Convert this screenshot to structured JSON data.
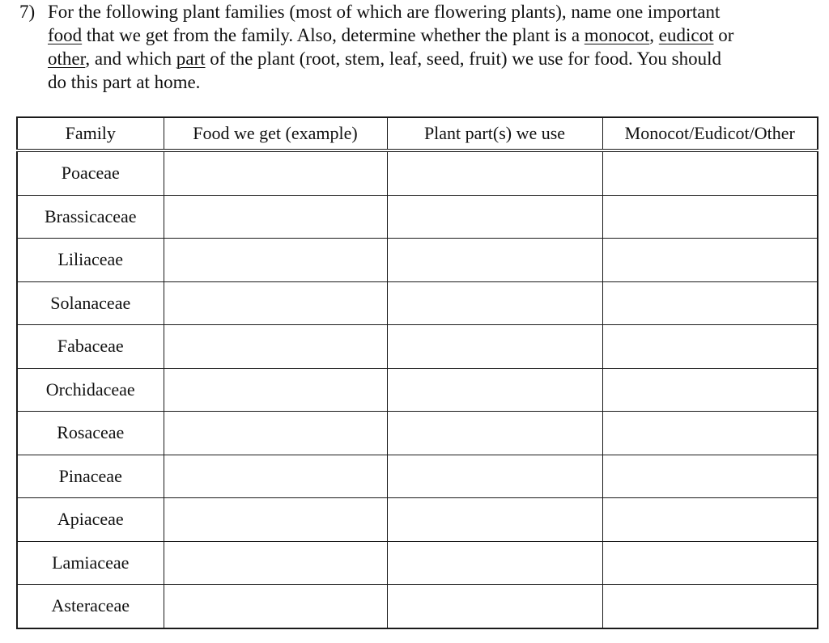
{
  "question": {
    "number": "7)",
    "line1": "For the following plant families (most of which are flowering plants), name one important",
    "line2_u1": "food",
    "line2_a": " that we get from the family. Also, determine whether the plant is a ",
    "line2_u2": "monocot",
    "line2_b": ", ",
    "line2_u3": "eudicot",
    "line2_c": " or",
    "line3_u1": "other",
    "line3_a": ", and which ",
    "line3_u2": "part",
    "line3_b": " of the plant (root, stem, leaf, seed, fruit) we use for food. You should",
    "line4": "do this part at home."
  },
  "table": {
    "headers": [
      "Family",
      "Food we get (example)",
      "Plant part(s) we use",
      "Monocot/Eudicot/Other"
    ],
    "rows": [
      {
        "family": "Poaceae",
        "food": "",
        "part": "",
        "type": ""
      },
      {
        "family": "Brassicaceae",
        "food": "",
        "part": "",
        "type": ""
      },
      {
        "family": "Liliaceae",
        "food": "",
        "part": "",
        "type": ""
      },
      {
        "family": "Solanaceae",
        "food": "",
        "part": "",
        "type": ""
      },
      {
        "family": "Fabaceae",
        "food": "",
        "part": "",
        "type": ""
      },
      {
        "family": "Orchidaceae",
        "food": "",
        "part": "",
        "type": ""
      },
      {
        "family": "Rosaceae",
        "food": "",
        "part": "",
        "type": ""
      },
      {
        "family": "Pinaceae",
        "food": "",
        "part": "",
        "type": ""
      },
      {
        "family": "Apiaceae",
        "food": "",
        "part": "",
        "type": ""
      },
      {
        "family": "Lamiaceae",
        "food": "",
        "part": "",
        "type": ""
      },
      {
        "family": "Asteraceae",
        "food": "",
        "part": "",
        "type": ""
      }
    ]
  }
}
